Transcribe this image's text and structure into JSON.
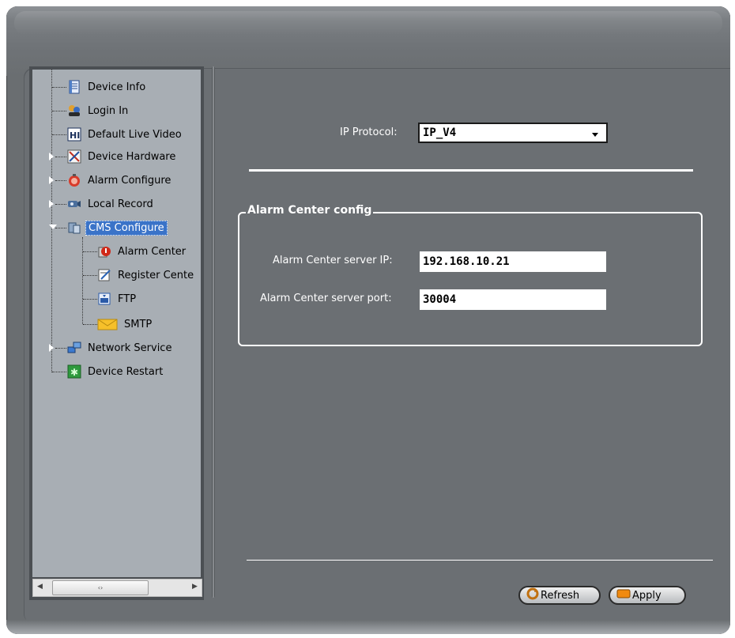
{
  "tree": {
    "items": [
      {
        "label": "Device Info",
        "icon": "document-icon",
        "expandable": false
      },
      {
        "label": "Login In",
        "icon": "users-key-icon",
        "expandable": false
      },
      {
        "label": "Default Live Video",
        "icon": "video-grid-icon",
        "expandable": false
      },
      {
        "label": "Device Hardware",
        "icon": "hardware-tools-icon",
        "expandable": true
      },
      {
        "label": "Alarm Configure",
        "icon": "alarm-icon",
        "expandable": true
      },
      {
        "label": "Local Record",
        "icon": "camera-icon",
        "expandable": true
      },
      {
        "label": "CMS Configure",
        "icon": "cms-icon",
        "expandable": true,
        "expanded": true,
        "selected": true
      },
      {
        "label": "Alarm Center",
        "icon": "alarm-center-icon",
        "child": true
      },
      {
        "label": "Register Cente",
        "icon": "register-icon",
        "child": true
      },
      {
        "label": "FTP",
        "icon": "ftp-icon",
        "child": true
      },
      {
        "label": "SMTP",
        "icon": "envelope-icon",
        "child": true
      },
      {
        "label": "Network Service",
        "icon": "network-icon",
        "expandable": true
      },
      {
        "label": "Device Restart",
        "icon": "restart-icon",
        "expandable": false
      }
    ],
    "scrollbar": {
      "thumb_glyph": "‹›",
      "left_arrow": "◀",
      "right_arrow": "▶"
    }
  },
  "main": {
    "ip_protocol_label": "IP Protocol:",
    "ip_protocol_value": "IP_V4",
    "group_title": "Alarm Center config",
    "server_ip_label": "Alarm Center server IP:",
    "server_ip_value": "192.168.10.21",
    "server_port_label": "Alarm Center server port:",
    "server_port_value": "30004"
  },
  "buttons": {
    "refresh": "Refresh",
    "apply": "Apply"
  },
  "colors": {
    "background": "#6b6f73",
    "tree_bg": "#a8aeb4",
    "selection": "#3a73c8",
    "label_text": "#ffffff"
  }
}
